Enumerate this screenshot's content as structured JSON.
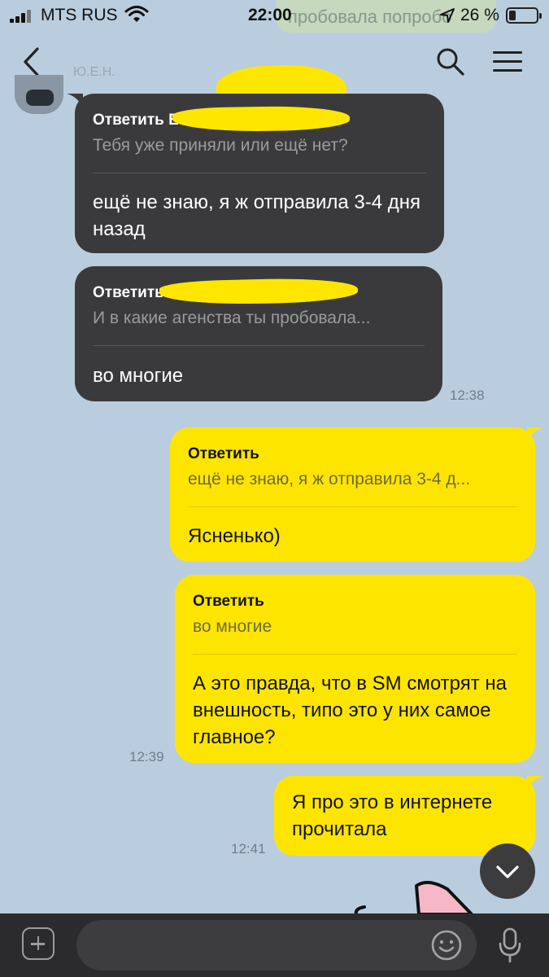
{
  "status_bar": {
    "carrier": "MTS RUS",
    "time": "22:00",
    "ghost_text": "пробовала попробо",
    "battery": "26 %"
  },
  "chat": {
    "sender_name": "Ю.Е.Н.",
    "messages": [
      {
        "side": "incoming",
        "reply_label": "Ответить Е",
        "reply_quote": "Тебя уже приняли или ещё нет?",
        "text": "ещё не знаю, я ж отправила 3-4 дня назад",
        "time": ""
      },
      {
        "side": "incoming",
        "reply_label": "Ответить",
        "reply_quote": "И в какие агенства ты пробовала...",
        "text": "во многие",
        "time": "12:38"
      },
      {
        "side": "outgoing",
        "reply_label": "Ответить",
        "reply_quote": "ещё не знаю, я ж отправила 3-4 д...",
        "text": "Ясненько)",
        "time": ""
      },
      {
        "side": "outgoing",
        "reply_label": "Ответить",
        "reply_quote": "во многие",
        "text": "А это правда, что в SM смотрят на внешность, типо это у них самое главное?",
        "time": "12:39"
      },
      {
        "side": "outgoing",
        "text": "Я про это в интернете прочитала",
        "time": "12:41"
      }
    ]
  },
  "colors": {
    "background": "#bacdde",
    "incoming_bubble": "#3a3a3c",
    "outgoing_bubble": "#fee500",
    "input_bar": "#2b2b2d"
  },
  "icons": [
    "back-arrow-icon",
    "search-icon",
    "menu-icon",
    "chevron-down-icon",
    "plus-icon",
    "emoji-icon",
    "microphone-icon"
  ]
}
